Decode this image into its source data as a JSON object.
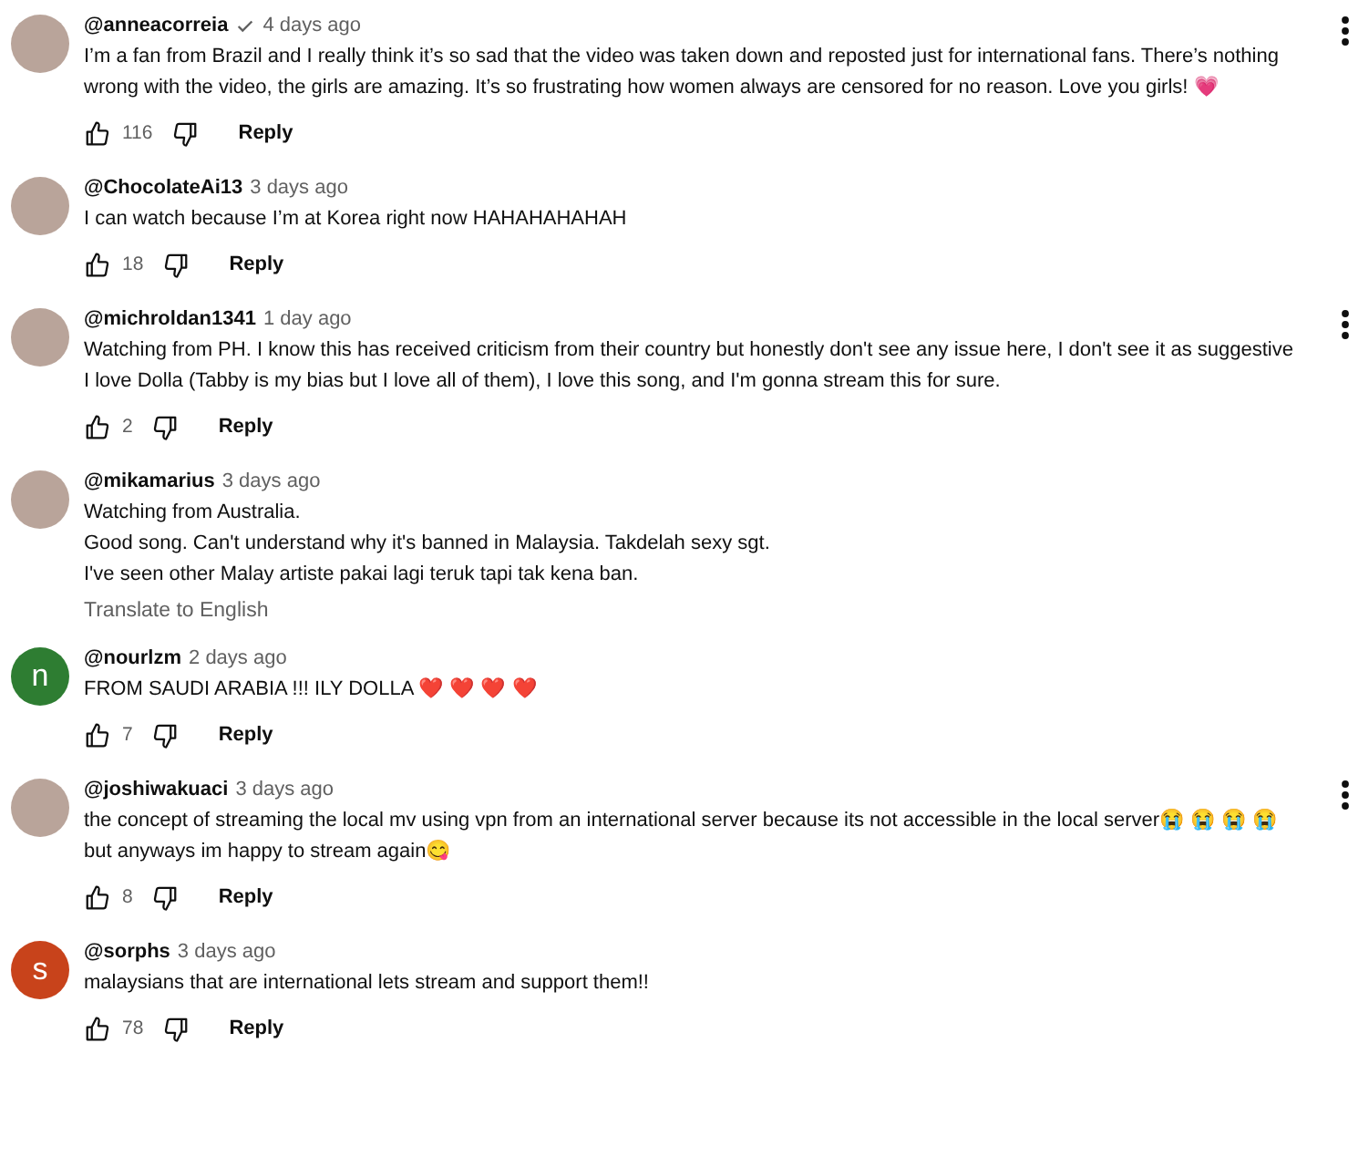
{
  "comments": [
    {
      "author": "@anneacorreia",
      "verified": true,
      "time": "4 days ago",
      "avatar": {
        "kind": "photo"
      },
      "menu": true,
      "lines": [
        "I’m a fan from Brazil and I really think it’s so sad that the video was taken down and reposted just for international fans. There’s nothing wrong with the video, the girls are amazing. It’s so frustrating how women always are censored for no reason. Love you girls! 💗"
      ],
      "likes": "116",
      "reply": "Reply"
    },
    {
      "author": "@ChocolateAi13",
      "verified": false,
      "time": "3 days ago",
      "avatar": {
        "kind": "photo"
      },
      "menu": false,
      "lines": [
        "I can watch because I’m at Korea right now HAHAHAHAHAH"
      ],
      "likes": "18",
      "reply": "Reply"
    },
    {
      "author": "@michroldan1341",
      "verified": false,
      "time": "1 day ago",
      "avatar": {
        "kind": "photo"
      },
      "menu": true,
      "lines": [
        "Watching from PH. I know this has received criticism from their country but honestly don't see any issue here, I don't see it as suggestive",
        "I love Dolla (Tabby is my bias but I love all of them), I love this song, and I'm gonna stream this for sure."
      ],
      "likes": "2",
      "reply": "Reply"
    },
    {
      "author": "@mikamarius",
      "verified": false,
      "time": "3 days ago",
      "avatar": {
        "kind": "photo"
      },
      "menu": false,
      "lines": [
        "Watching from Australia.",
        "Good song. Can't understand why it's banned in Malaysia. Takdelah sexy sgt.",
        "I've seen other Malay artiste pakai lagi teruk tapi tak kena ban."
      ],
      "translate": "Translate to English"
    },
    {
      "author": "@nourlzm",
      "verified": false,
      "time": "2 days ago",
      "avatar": {
        "kind": "letter",
        "letter": "n",
        "color": "#2e7d32"
      },
      "menu": false,
      "lines": [
        "FROM SAUDI ARABIA !!! ILY DOLLA ❤️ ❤️ ❤️ ❤️"
      ],
      "likes": "7",
      "reply": "Reply"
    },
    {
      "author": "@joshiwakuaci",
      "verified": false,
      "time": "3 days ago",
      "avatar": {
        "kind": "photo"
      },
      "menu": true,
      "lines": [
        "the concept of streaming the local mv using vpn from an international server because its not accessible in the local server😭 😭 😭 😭",
        "but anyways im happy to stream again😋"
      ],
      "likes": "8",
      "reply": "Reply"
    },
    {
      "author": "@sorphs",
      "verified": false,
      "time": "3 days ago",
      "avatar": {
        "kind": "letter",
        "letter": "s",
        "color": "#c8431b"
      },
      "menu": false,
      "lines": [
        "malaysians that are international lets stream and support them!!"
      ],
      "likes": "78",
      "reply": "Reply"
    }
  ]
}
